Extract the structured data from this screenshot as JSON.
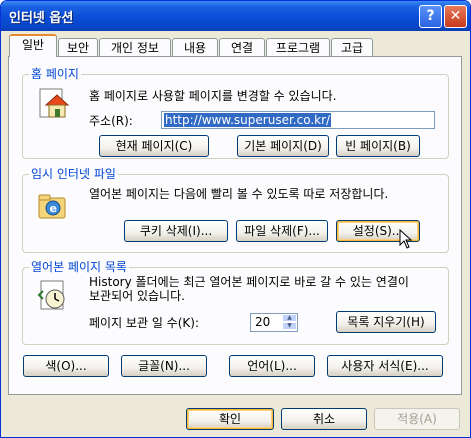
{
  "window": {
    "title": "인터넷 옵션",
    "help_glyph": "?",
    "close_glyph": "✕"
  },
  "tabs": [
    "일반",
    "보안",
    "개인 정보",
    "내용",
    "연결",
    "프로그램",
    "고급"
  ],
  "homepage": {
    "legend": "홈 페이지",
    "description": "홈 페이지로 사용할 페이지를 변경할 수 있습니다.",
    "address_label": "주소(R):",
    "address_value": "http://www.superuser.co.kr/",
    "btn_current": "현재 페이지(C)",
    "btn_default": "기본 페이지(D)",
    "btn_blank": "빈 페이지(B)"
  },
  "temp_files": {
    "legend": "임시 인터넷 파일",
    "description": "열어본 페이지는 다음에 빨리 볼 수 있도록 따로 저장합니다.",
    "btn_cookies": "쿠키 삭제(I)...",
    "btn_files": "파일 삭제(F)...",
    "btn_settings": "설정(S)..."
  },
  "history": {
    "legend": "열어본 페이지 목록",
    "description_1": "History 폴더에는 최근 열어본 페이지로 바로 갈 수 있는 연결이",
    "description_2": "보관되어 있습니다.",
    "days_label": "페이지 보관 일 수(K):",
    "days_value": "20",
    "btn_clear": "목록 지우기(H)"
  },
  "bottom_buttons": [
    "색(O)...",
    "글꼴(N)...",
    "언어(L)...",
    "사용자 서식(E)..."
  ],
  "dialog_buttons": {
    "ok": "확인",
    "cancel": "취소",
    "apply": "적용(A)"
  },
  "colors": {
    "titlebar": "#0a4dd8",
    "legend": "#0046d5",
    "selection": "#316ac5"
  }
}
